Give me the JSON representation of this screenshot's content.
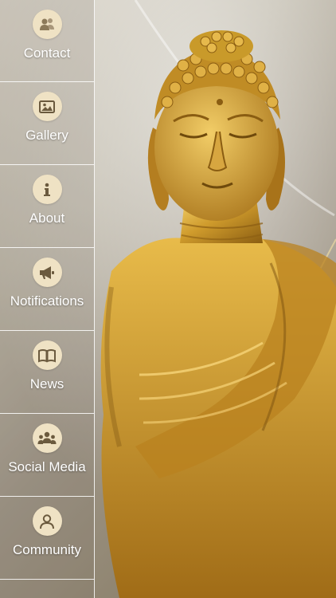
{
  "theme": {
    "icon_bg": "#efe2c4",
    "icon_fg": "#6b5a3e",
    "label_color": "#ffffff",
    "gold": "#c99a2a"
  },
  "menu": {
    "items": [
      {
        "label": "Contact",
        "icon": "contact-people-icon"
      },
      {
        "label": "Gallery",
        "icon": "gallery-image-icon"
      },
      {
        "label": "About",
        "icon": "info-icon"
      },
      {
        "label": "Notifications",
        "icon": "megaphone-icon"
      },
      {
        "label": "News",
        "icon": "book-icon"
      },
      {
        "label": "Social Media",
        "icon": "group-people-icon"
      },
      {
        "label": "Community",
        "icon": "user-icon"
      }
    ]
  }
}
